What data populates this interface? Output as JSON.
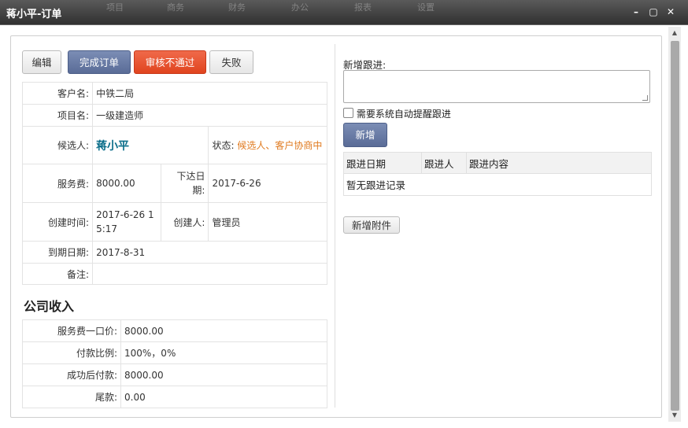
{
  "window": {
    "title": "蒋小平-订单",
    "controls": [
      "–",
      "▢",
      "✕"
    ]
  },
  "background_nav": [
    "项目",
    "商务",
    "财务",
    "办公",
    "报表",
    "设置"
  ],
  "actions": {
    "edit": "编辑",
    "complete": "完成订单",
    "reject": "审核不通过",
    "fail": "失败"
  },
  "info": {
    "customer_label": "客户名:",
    "customer": "中铁二局",
    "project_label": "项目名:",
    "project": "一级建造师",
    "candidate_label": "候选人:",
    "candidate": "蒋小平",
    "status_label": "状态:",
    "status": "候选人、客户协商中",
    "fee_label": "服务费:",
    "fee": "8000.00",
    "order_date_label": "下达日期:",
    "order_date": "2017-6-26",
    "created_label": "创建时间:",
    "created": "2017-6-26 15:17",
    "creator_label": "创建人:",
    "creator": "管理员",
    "expire_label": "到期日期:",
    "expire": "2017-8-31",
    "note_label": "备注:",
    "note": ""
  },
  "income": {
    "title": "公司收入",
    "rows": [
      {
        "label": "服务费一口价:",
        "value": "8000.00"
      },
      {
        "label": "付款比例:",
        "value": "100%，0%"
      },
      {
        "label": "成功后付款:",
        "value": "8000.00"
      },
      {
        "label": "尾款:",
        "value": "0.00"
      }
    ]
  },
  "followup": {
    "new_label": "新增跟进:",
    "textarea_value": "",
    "auto_remind_label": "需要系统自动提醒跟进",
    "add_button": "新增",
    "columns": [
      "跟进日期",
      "跟进人",
      "跟进内容"
    ],
    "empty_text": "暂无跟进记录",
    "attach_button": "新增附件"
  },
  "colors": {
    "blue_button": "#6678a3",
    "red_button": "#e8502d",
    "candidate": "#0b6e8a",
    "status": "#e07a1f"
  }
}
